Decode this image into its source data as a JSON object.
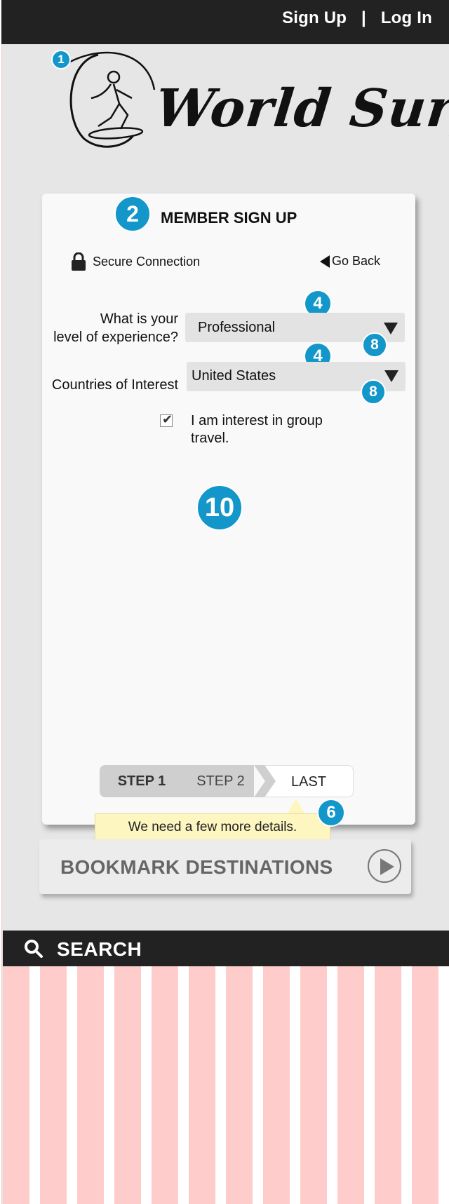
{
  "header": {
    "signup_label": "Sign Up",
    "separator": "|",
    "login_label": "Log In"
  },
  "logo": {
    "text": "World Surf"
  },
  "markers": {
    "m1": "1",
    "m2": "2",
    "m4a": "4",
    "m4b": "4",
    "m8a": "8",
    "m8b": "8",
    "m10": "10",
    "m6": "6"
  },
  "form": {
    "title": "MEMBER SIGN UP",
    "secure_label": "Secure Connection",
    "back_label": "Go Back",
    "experience_label_line1": "What is your",
    "experience_label_line2": "level of experience?",
    "experience_value": "Professional",
    "countries_label": "Countries of Interest",
    "countries_value": "United States",
    "group_travel_label": "I am interest in group travel.",
    "group_travel_checked": true
  },
  "steps": {
    "step1": "STEP 1",
    "step2": "STEP 2",
    "last": "LAST"
  },
  "tooltip": {
    "text": "We need a few more details."
  },
  "bookmark": {
    "label": "BOOKMARK DESTINATIONS"
  },
  "search": {
    "label": "SEARCH"
  },
  "colors": {
    "header_bg": "#222222",
    "marker": "#1396c9",
    "stripe": "#ffcccc",
    "tooltip_bg": "#fdf6c0"
  }
}
